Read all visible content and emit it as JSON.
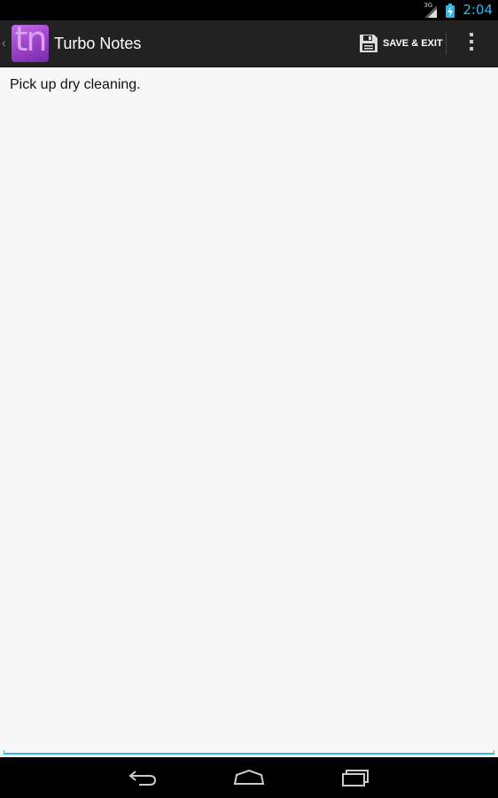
{
  "status_bar": {
    "network_label": "3G",
    "time": "2:04",
    "accent_color": "#33b5e5"
  },
  "action_bar": {
    "logo_text": "tn",
    "title": "Turbo Notes",
    "save_exit_label": "SAVE & EXIT",
    "icons": {
      "up": "chevron-left-icon",
      "save": "floppy-disk-icon",
      "overflow": "overflow-menu-icon"
    }
  },
  "editor": {
    "text": "Pick up dry cleaning.",
    "underline_color": "#33b5e5"
  },
  "nav_bar": {
    "icons": [
      "back-icon",
      "home-icon",
      "recent-apps-icon"
    ]
  }
}
